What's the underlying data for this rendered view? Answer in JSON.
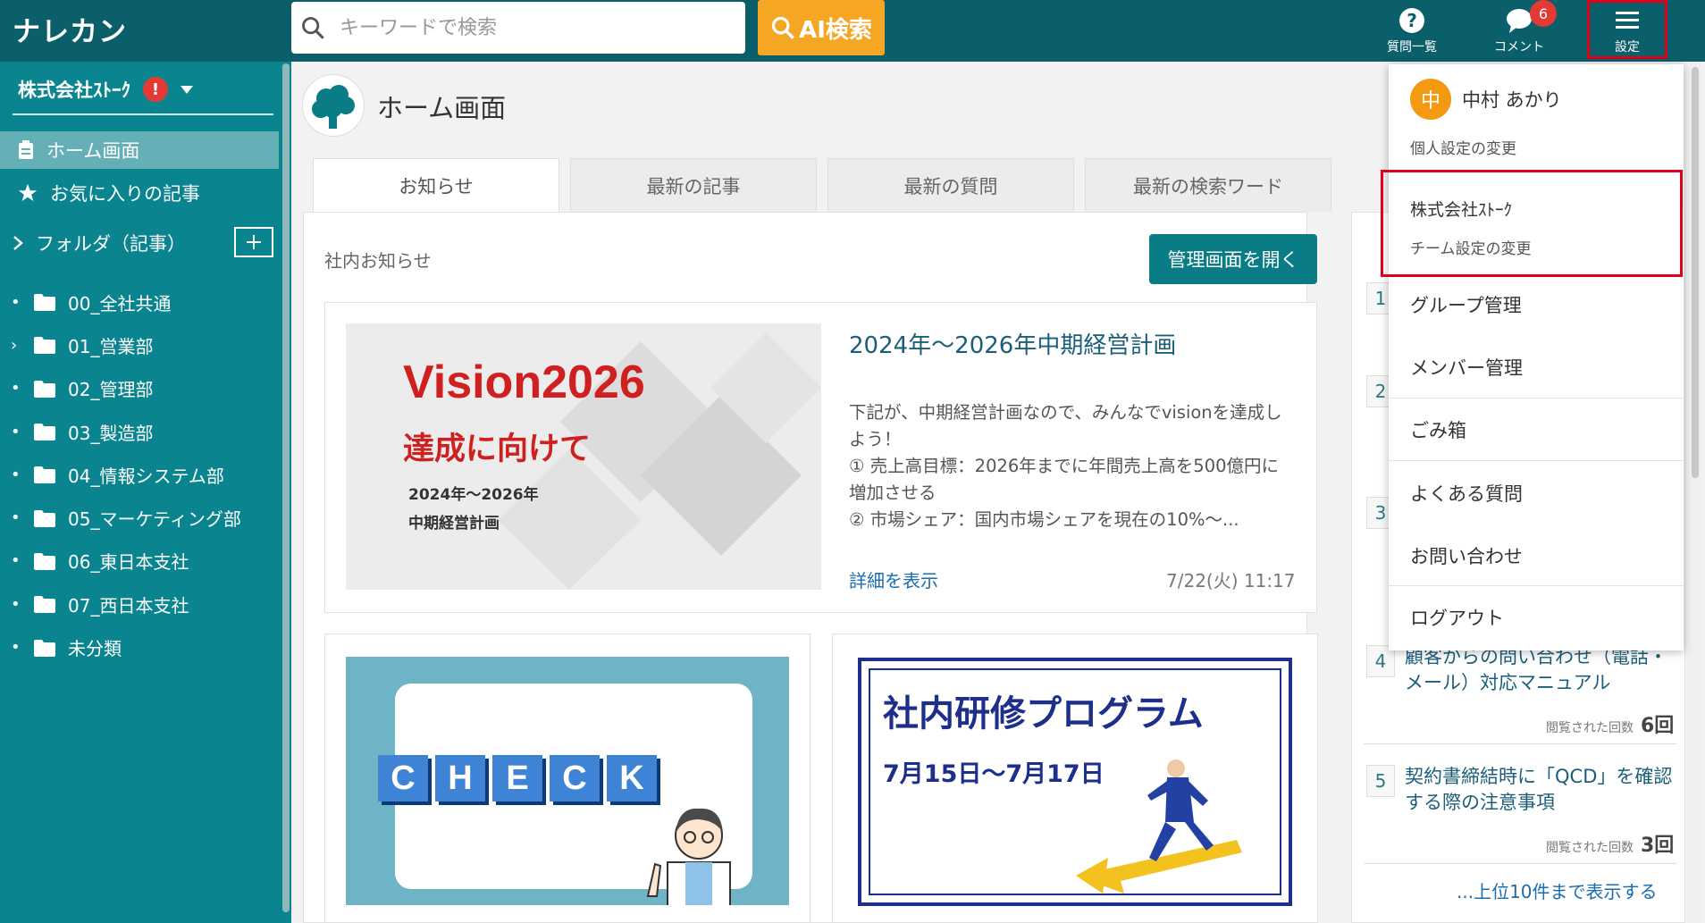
{
  "header": {
    "logo": "ナレカン",
    "search_placeholder": "キーワードで検索",
    "ai_search_label": "AI検索",
    "questions_label": "質問一覧",
    "comments_label": "コメント",
    "comments_badge": "6",
    "settings_label": "設定"
  },
  "sidebar": {
    "company": "株式会社ｽﾄｰｸ",
    "warning": "!",
    "home": "ホーム画面",
    "favorites": "お気に入りの記事",
    "folder_header": "フォルダ（記事）",
    "folders": [
      {
        "label": "00_全社共通",
        "bullet": "•"
      },
      {
        "label": "01_営業部",
        "bullet": "›"
      },
      {
        "label": "02_管理部",
        "bullet": "•"
      },
      {
        "label": "03_製造部",
        "bullet": "•"
      },
      {
        "label": "04_情報システム部",
        "bullet": "•"
      },
      {
        "label": "05_マーケティング部",
        "bullet": "•"
      },
      {
        "label": "06_東日本支社",
        "bullet": "•"
      },
      {
        "label": "07_西日本支社",
        "bullet": "•"
      },
      {
        "label": "未分類",
        "bullet": "•"
      }
    ]
  },
  "main": {
    "page_title": "ホーム画面",
    "tabs": [
      "お知らせ",
      "最新の記事",
      "最新の質問",
      "最新の検索ワード"
    ],
    "section_label": "社内お知らせ",
    "manage_button": "管理画面を開く",
    "featured": {
      "image_title": "Vision2026",
      "image_sub": "達成に向けて",
      "image_line1": "2024年〜2026年",
      "image_line2": "中期経営計画",
      "title": "2024年〜2026年中期経営計画",
      "body": "下記が、中期経営計画なので、みんなでvisionを達成しよう！\n① 売上高目標：2026年までに年間売上高を500億円に増加させる\n② 市場シェア：国内市場シェアを現在の10%〜...",
      "link": "詳細を表示",
      "date": "7/22(火) 11:17"
    },
    "card_check_letters": [
      "C",
      "H",
      "E",
      "C",
      "K"
    ],
    "card_training_title": "社内研修プログラム",
    "card_training_date": "7月15日〜7月17日"
  },
  "ranking": {
    "items": [
      {
        "rank": "1"
      },
      {
        "rank": "2"
      },
      {
        "rank": "3"
      },
      {
        "rank": "4",
        "title": "顧客からの問い合わせ（電話・メール）対応マニュアル",
        "views_label": "閲覧された回数",
        "views": "6回"
      },
      {
        "rank": "5",
        "title": "契約書締結時に「QCD」を確認する際の注意事項",
        "views_label": "閲覧された回数",
        "views": "3回"
      }
    ],
    "more_link": "...上位10件まで表示する"
  },
  "dropdown": {
    "avatar_initial": "中",
    "user_name": "中村 あかり",
    "personal_settings": "個人設定の変更",
    "company": "株式会社ｽﾄｰｸ",
    "team_settings": "チーム設定の変更",
    "group_mgmt": "グループ管理",
    "member_mgmt": "メンバー管理",
    "trash": "ごみ箱",
    "faq": "よくある質問",
    "contact": "お問い合わせ",
    "logout": "ログアウト"
  },
  "colors": {
    "header": "#0b5f6a",
    "sidebar": "#0a8590",
    "accent_orange": "#f5a623",
    "highlight_red": "#e0001b"
  }
}
